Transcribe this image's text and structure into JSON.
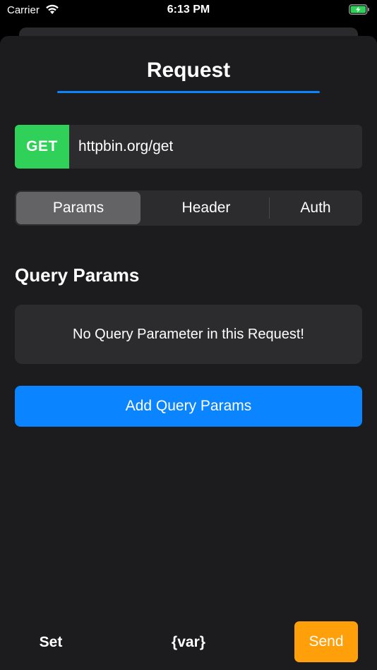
{
  "status_bar": {
    "carrier": "Carrier",
    "time": "6:13 PM",
    "wifi_icon": "wifi-icon",
    "battery_icon": "battery-charging-icon"
  },
  "request": {
    "title": "Request",
    "method": "GET",
    "url": "httpbin.org/get"
  },
  "tabs": [
    {
      "label": "Params",
      "selected": true
    },
    {
      "label": "Header",
      "selected": false
    },
    {
      "label": "Auth",
      "selected": false
    }
  ],
  "params": {
    "section_title": "Query Params",
    "empty_message": "No Query Parameter in this Request!",
    "add_button_label": "Add Query Params"
  },
  "toolbar": {
    "set_label": "Set",
    "var_label": "{var}",
    "send_label": "Send"
  },
  "colors": {
    "accent": "#0a84ff",
    "method_get": "#30d158",
    "send": "#ff9f0a",
    "background": "#1c1c1e",
    "surface": "#2c2c2e"
  }
}
